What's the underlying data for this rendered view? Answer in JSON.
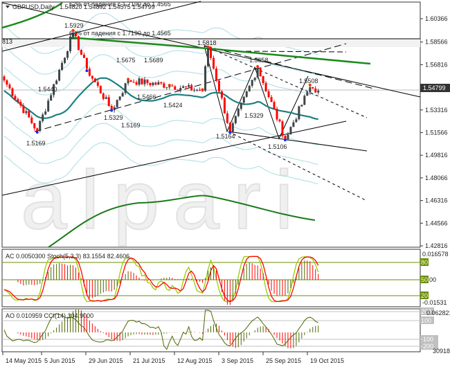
{
  "header": {
    "symbol": "GBPUSD,Daily",
    "ohlc": "1.54820 1.54802 1.54575 1.54799"
  },
  "watermark": "alpari",
  "chart_data": {
    "type": "candlestick",
    "title": "GBPUSD,Daily",
    "price_ticks": [
      "1.60366",
      "1.58566",
      "1.56816",
      "1.55066",
      "1.53316",
      "1.51566",
      "1.49816",
      "1.48066",
      "1.46316",
      "1.44566",
      "1.42816"
    ],
    "ylim": [
      1.42816,
      1.60366
    ],
    "current_price": "1.54799",
    "date_ticks": [
      "14 May 2015",
      "5 Jun 2015",
      "29 Jun 2015",
      "21 Jul 2015",
      "12 Aug 2015",
      "3 Sep 2015",
      "25 Sep 2015",
      "19 Oct 2015"
    ],
    "swing_waypoints": [
      [
        0,
        1.556
      ],
      [
        12,
        1.517
      ],
      [
        25,
        1.5929
      ],
      [
        30,
        1.565
      ],
      [
        39,
        1.533
      ],
      [
        45,
        1.556
      ],
      [
        60,
        1.552
      ],
      [
        72,
        1.548
      ],
      [
        74,
        1.5818
      ],
      [
        82,
        1.5164
      ],
      [
        92,
        1.5658
      ],
      [
        102,
        1.5106
      ],
      [
        111,
        1.5508
      ],
      [
        114,
        1.548
      ]
    ],
    "annotations": [
      {
        "text": "62% от падения с 1.7190 до 1.4565"
      },
      {
        "text": "62% от падения с 1.7190 до 1.4565"
      },
      {
        "text": "813"
      },
      {
        "text": "1.5929"
      },
      {
        "text": "1.5440"
      },
      {
        "text": "1.5169"
      },
      {
        "text": "1.5329"
      },
      {
        "text": "1.5169"
      },
      {
        "text": "1.5675"
      },
      {
        "text": "1.5689"
      },
      {
        "text": "1.5466"
      },
      {
        "text": "1.5424"
      },
      {
        "text": "1.5818"
      },
      {
        "text": "1.5164"
      },
      {
        "text": "1.5658"
      },
      {
        "text": "1.5329"
      },
      {
        "text": "1.5106"
      },
      {
        "text": "1.5508"
      }
    ],
    "ac_stoch": {
      "label": "AC 0.0050300  Stoch(5,3,3) 83.1554 82.4606",
      "max": "0.016578",
      "min": "-0.01531",
      "levels": [
        "80",
        "50",
        "20"
      ],
      "zero": "00"
    },
    "ao_cci": {
      "label": "AO 0.010959  CCI(14) 104.9000",
      "max": "0.062821",
      "min": "30918",
      "levels": [
        "200",
        "100",
        "-100",
        "-200"
      ]
    }
  }
}
